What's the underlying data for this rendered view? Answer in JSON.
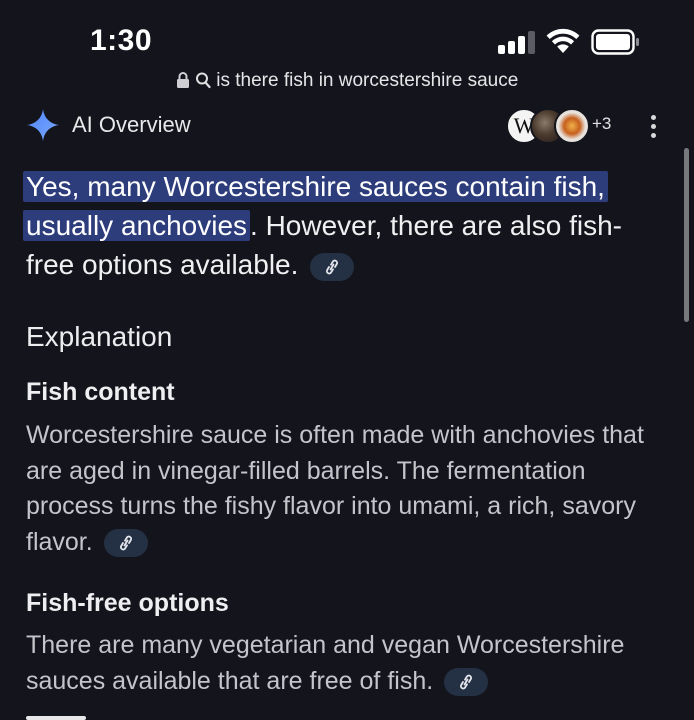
{
  "status_bar": {
    "time": "1:30"
  },
  "url_bar": {
    "query": "is there fish in worcestershire sauce",
    "icons": [
      "lock-icon",
      "search-icon"
    ]
  },
  "ai_overview": {
    "title": "AI Overview",
    "sources": {
      "icons": [
        "wikipedia-icon",
        "photo-icon",
        "food-icon"
      ],
      "wiki_letter": "W",
      "more_count": "+3"
    },
    "answer": {
      "highlighted_line1": "Yes, many Worcestershire sauces contain fish,",
      "highlighted_line2": "usually anchovies",
      "rest": ". However, there are also fish-free options available."
    },
    "section_heading": "Explanation",
    "items": [
      {
        "heading": "Fish content",
        "text": "Worcestershire sauce is often made with anchovies that are aged in vinegar-filled barrels. The fermentation process turns the fishy flavor into umami, a rich, savory flavor."
      },
      {
        "heading": "Fish-free options",
        "text": "There are many vegetarian and vegan Worcestershire sauces available that are free of fish."
      }
    ]
  },
  "colors": {
    "background": "#14151c",
    "highlight": "#2d3d7c",
    "chip": "#243043",
    "accent_sparkle": "#5b8ff7"
  }
}
